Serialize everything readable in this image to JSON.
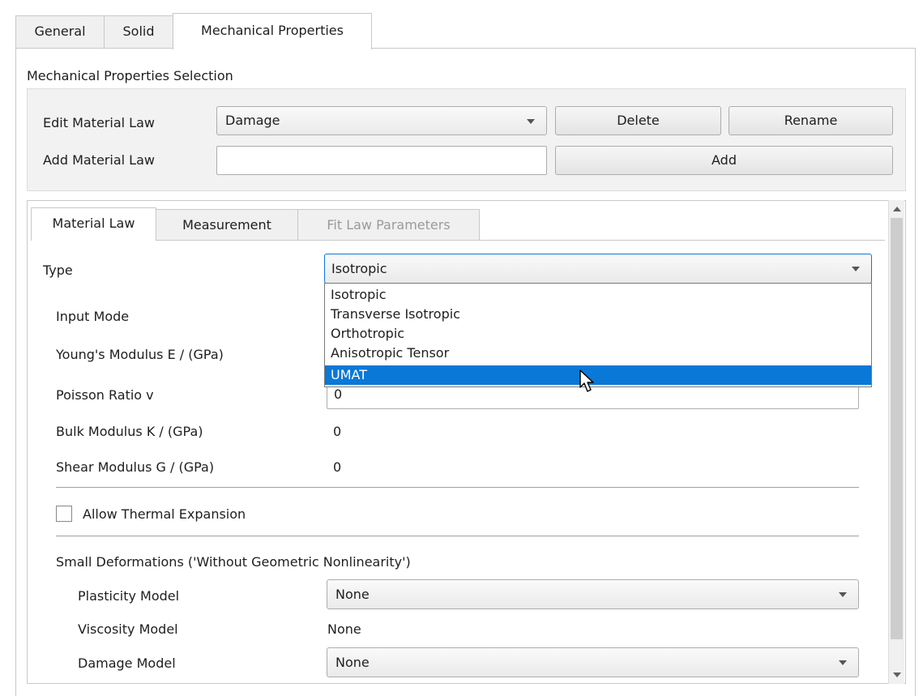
{
  "tabs": [
    "General",
    "Solid",
    "Mechanical Properties"
  ],
  "selection": {
    "title": "Mechanical Properties Selection",
    "edit_label": "Edit Material Law",
    "edit_value": "Damage",
    "delete_label": "Delete",
    "rename_label": "Rename",
    "add_label": "Add Material Law",
    "add_value": "",
    "add_button": "Add"
  },
  "inner_tabs": [
    "Material Law",
    "Measurement",
    "Fit Law Parameters"
  ],
  "material": {
    "type_label": "Type",
    "type_value": "Isotropic",
    "type_options": [
      "Isotropic",
      "Transverse Isotropic",
      "Orthotropic",
      "Anisotropic Tensor",
      "UMAT"
    ],
    "selected_option": "UMAT",
    "input_mode_label": "Input Mode",
    "youngs_label": "Young's Modulus E / (GPa)",
    "poisson_label": "Poisson Ratio v",
    "poisson_value": "0",
    "bulk_label": "Bulk Modulus K / (GPa)",
    "bulk_value": "0",
    "shear_label": "Shear Modulus G / (GPa)",
    "shear_value": "0",
    "thermal_label": "Allow Thermal Expansion",
    "thermal_checked": false,
    "small_def_label": "Small Deformations ('Without Geometric Nonlinearity')",
    "plasticity_label": "Plasticity Model",
    "plasticity_value": "None",
    "viscosity_label": "Viscosity Model",
    "viscosity_value": "None",
    "damage_label": "Damage Model",
    "damage_value": "None"
  },
  "colors": {
    "selection_blue": "#0a78d7"
  },
  "icons": {
    "cursor": "mouse-pointer-icon"
  }
}
